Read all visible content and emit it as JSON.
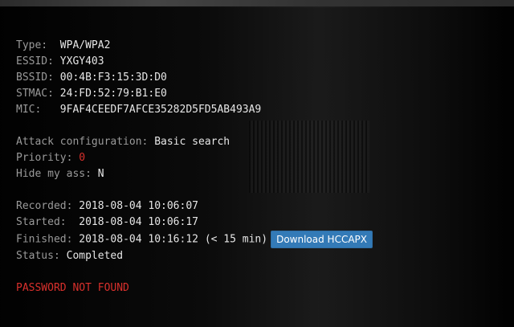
{
  "handshake": {
    "type_label": "Type:",
    "type_value": "WPA/WPA2",
    "essid_label": "ESSID:",
    "essid_value": "YXGY403",
    "bssid_label": "BSSID:",
    "bssid_value": "00:4B:F3:15:3D:D0",
    "stmac_label": "STMAC:",
    "stmac_value": "24:FD:52:79:B1:E0",
    "mic_label": "MIC:",
    "mic_value": "9FAF4CEEDF7AFCE35282D5FD5AB493A9"
  },
  "attack": {
    "config_label": "Attack configuration:",
    "config_value": "Basic search",
    "priority_label": "Priority:",
    "priority_value": "0",
    "hide_label": "Hide my ass:",
    "hide_value": "N"
  },
  "timing": {
    "recorded_label": "Recorded:",
    "recorded_value": "2018-08-04 10:06:07",
    "started_label": "Started:",
    "started_value": "2018-08-04 10:06:17",
    "finished_label": "Finished:",
    "finished_value": "2018-08-04 10:16:12 (< 15 min)",
    "download_button": "Download HCCAPX",
    "status_label": "Status:",
    "status_value": "Completed"
  },
  "result": {
    "message": "PASSWORD NOT FOUND"
  },
  "colors": {
    "accent_button": "#337ab7",
    "error_red": "#d9302c",
    "label_gray": "#9a9a9a"
  }
}
